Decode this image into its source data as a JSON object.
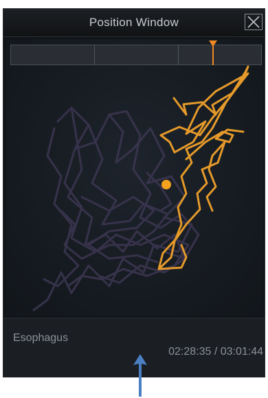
{
  "window": {
    "title": "Position Window",
    "close_icon": "close-icon"
  },
  "plot": {
    "background": "#161b21",
    "history_track_color": "#3b3550",
    "recent_track_color": "#e59a2a",
    "current_marker_color": "#f4a11d"
  },
  "status": {
    "location": "Esophagus",
    "time": "02:28:35 / 03:01:44"
  },
  "timeline": {
    "segments": 3,
    "progress": 0.807,
    "bar_color": "#2a2e34",
    "playhead_color": "#f08a24"
  },
  "annotation": {
    "arrow_color": "#4b7fc4",
    "arrow_icon": "up-arrow-icon"
  }
}
